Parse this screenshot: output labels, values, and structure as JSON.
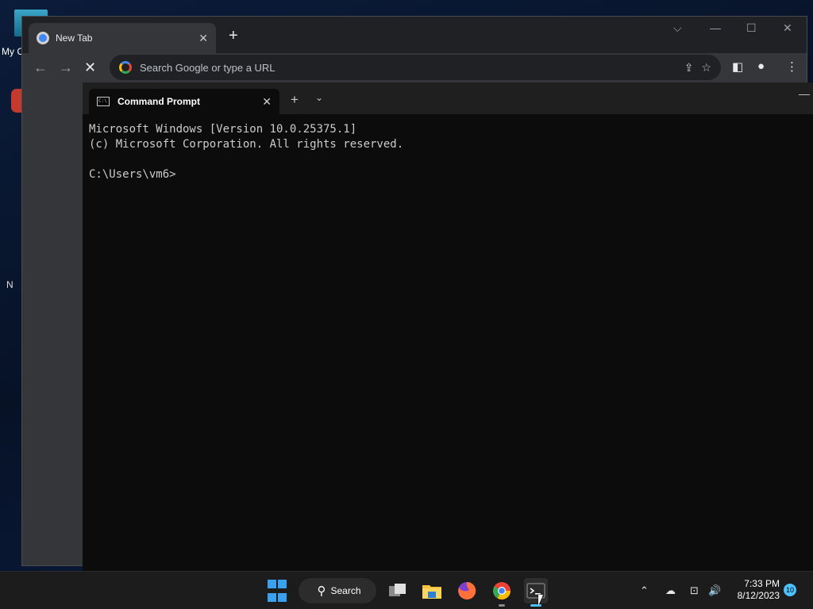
{
  "desktop": {
    "partial_label": "My C",
    "partial_letter": "N"
  },
  "chrome": {
    "tab_title": "New Tab",
    "tab_close": "✕",
    "new_tab": "+",
    "controls": {
      "dropdown": "⌵",
      "minimize": "—",
      "maximize": "☐",
      "close": "✕"
    },
    "nav": {
      "back": "←",
      "forward": "→",
      "stop": "✕"
    },
    "omnibox_placeholder": "Search Google or type a URL",
    "omnibox_icons": {
      "share": "⇪",
      "bookmark": "☆"
    },
    "toolbar_icons": {
      "side_panel": "◧",
      "profile": "●",
      "menu": "⋮"
    }
  },
  "terminal": {
    "tab_title": "Command Prompt",
    "tab_close": "✕",
    "new_tab": "+",
    "dropdown": "⌄",
    "minimize": "—",
    "cmd_icon_text": "C:\\",
    "output": "Microsoft Windows [Version 10.0.25375.1]\n(c) Microsoft Corporation. All rights reserved.\n\nC:\\Users\\vm6>"
  },
  "taskbar": {
    "search_label": "Search",
    "search_icon": "⚲",
    "apps": [
      "task-view",
      "file-explorer",
      "firefox",
      "chrome",
      "terminal"
    ],
    "tray": {
      "chevron": "⌃",
      "onedrive": "☁",
      "network": "⊡",
      "volume": "🔊"
    },
    "time": "7:33 PM",
    "date": "8/12/2023",
    "notification_count": "10"
  },
  "colors": {
    "accent": "#4cc2ff",
    "chrome_bg": "#35363a",
    "terminal_bg": "#0c0c0c",
    "taskbar_bg": "#1c1c1c"
  }
}
